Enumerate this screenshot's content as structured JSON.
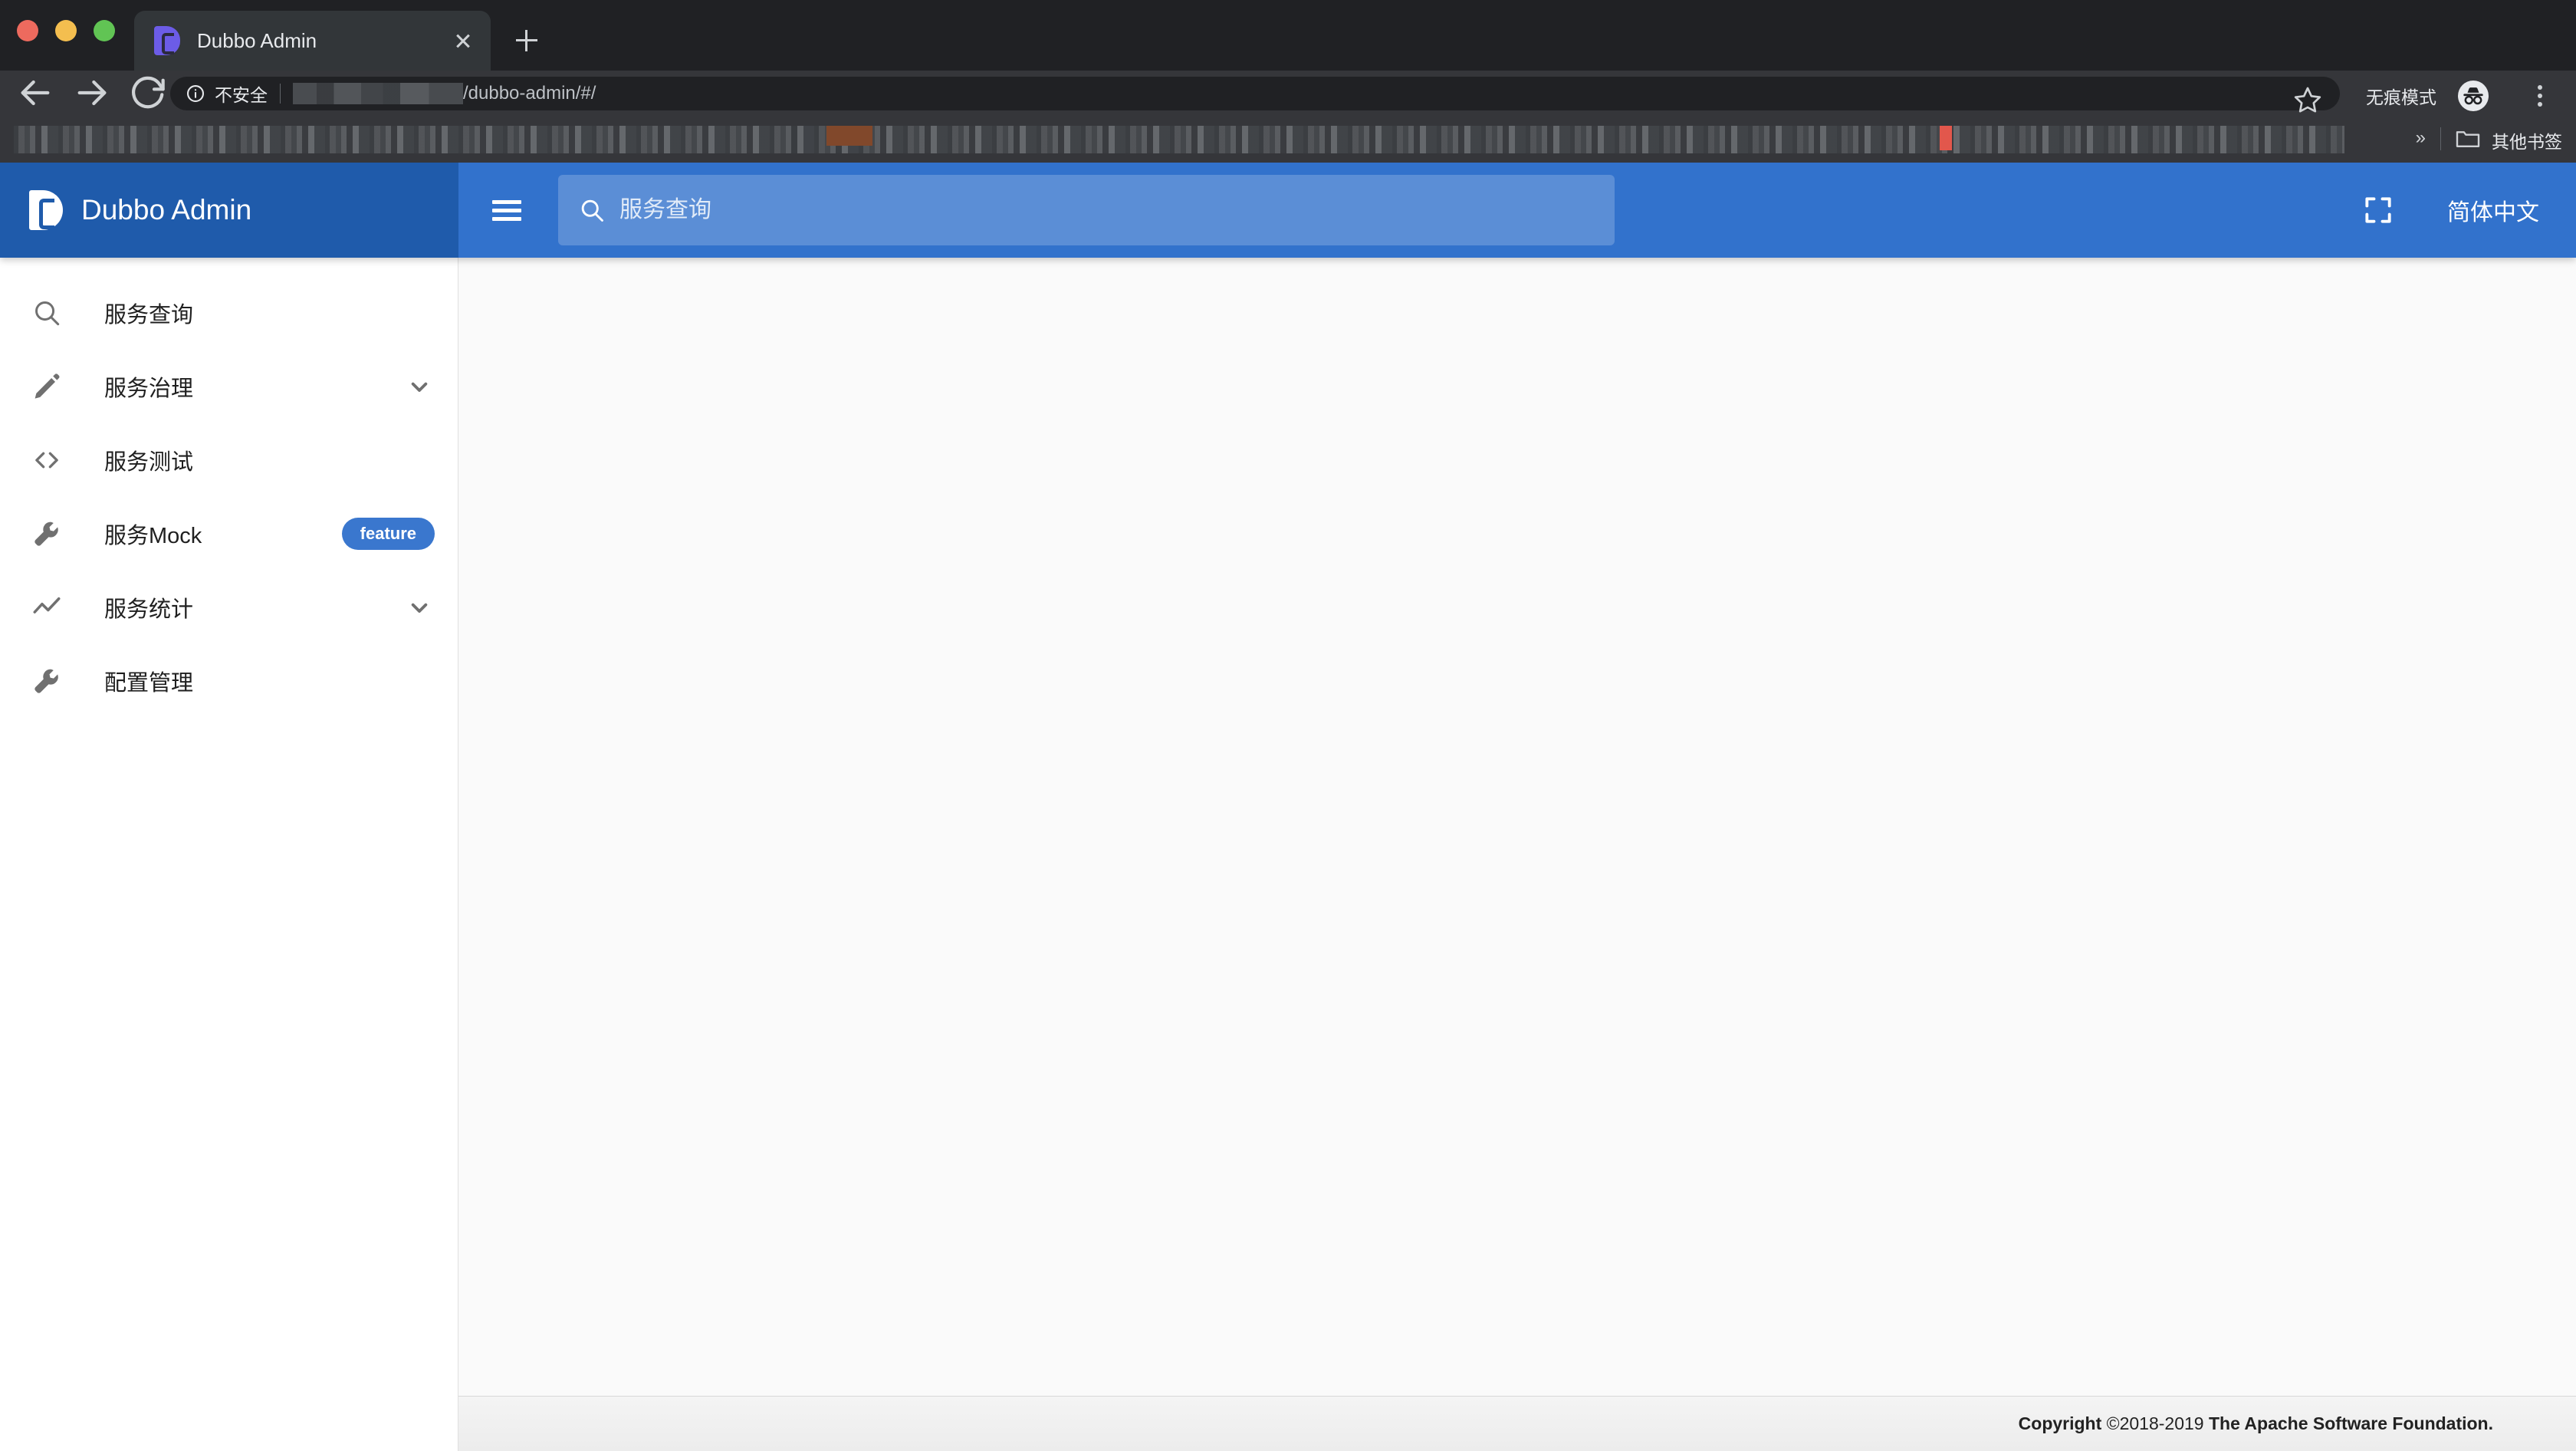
{
  "browser": {
    "window_controls": [
      "close",
      "minimize",
      "zoom"
    ],
    "tab": {
      "title": "Dubbo Admin",
      "favicon": "dubbo-logo-icon",
      "close_icon": "close-icon"
    },
    "new_tab_icon": "plus-icon",
    "toolbar": {
      "back_icon": "back-arrow-icon",
      "forward_icon": "forward-arrow-icon",
      "reload_icon": "reload-icon",
      "info_icon": "info-circle-icon",
      "security_label": "不安全",
      "url_text": "/dubbo-admin/#/",
      "bookmark_icon": "star-icon",
      "incognito_label": "无痕模式",
      "incognito_icon": "incognito-icon",
      "menu_icon": "kebab-menu-icon"
    },
    "bookmarks_bar": {
      "overflow_icon": "chevron-double-right-icon",
      "folder_icon": "folder-icon",
      "other_bookmarks_label": "其他书签"
    }
  },
  "app": {
    "brand": {
      "name": "Dubbo Admin",
      "logo": "dubbo-logo-icon",
      "bg_color": "#1f5bab"
    },
    "header": {
      "bg_color": "#3272cc",
      "menu_icon": "hamburger-icon",
      "search": {
        "icon": "search-icon",
        "placeholder": "服务查询",
        "value": ""
      },
      "fullscreen_icon": "fullscreen-icon",
      "language_label": "简体中文"
    },
    "sidebar": {
      "items": [
        {
          "label": "服务查询",
          "icon": "search-icon",
          "badge": null,
          "expandable": false
        },
        {
          "label": "服务治理",
          "icon": "pencil-icon",
          "badge": null,
          "expandable": true
        },
        {
          "label": "服务测试",
          "icon": "code-icon",
          "badge": null,
          "expandable": false
        },
        {
          "label": "服务Mock",
          "icon": "wrench-icon",
          "badge": "feature",
          "expandable": false
        },
        {
          "label": "服务统计",
          "icon": "trending-icon",
          "badge": null,
          "expandable": true
        },
        {
          "label": "配置管理",
          "icon": "wrench-icon",
          "badge": null,
          "expandable": false
        }
      ],
      "badge_color": "#3a77ce"
    },
    "content": {
      "body_text": ""
    },
    "footer": {
      "copyright_prefix": "Copyright",
      "copyright_years": "©2018-2019",
      "copyright_owner": "The Apache Software Foundation."
    }
  }
}
